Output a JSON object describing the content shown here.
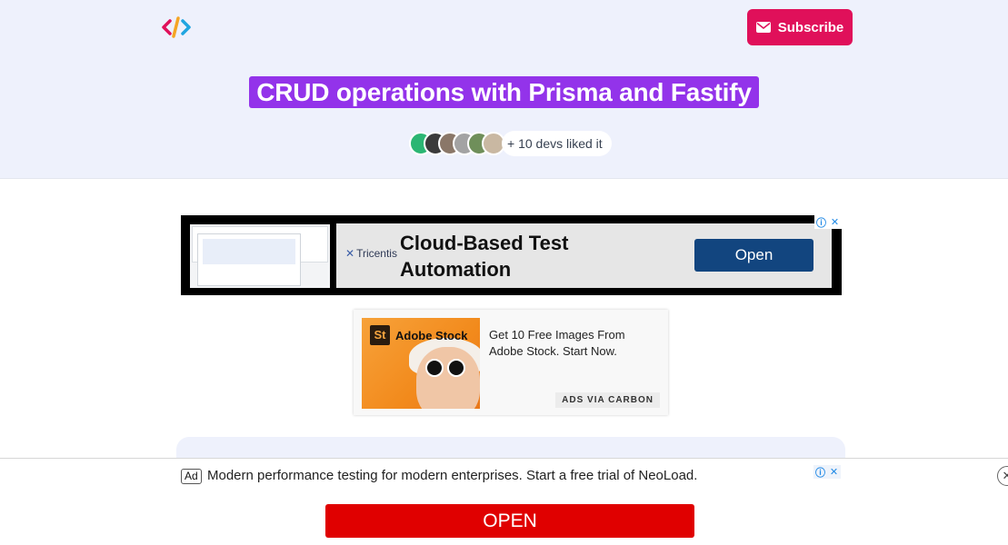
{
  "header": {
    "logo_icon": "code-brackets-icon",
    "subscribe_label": "Subscribe",
    "subscribe_icon": "envelope-icon",
    "accent": "#e0105a"
  },
  "article": {
    "title": "CRUD operations with Prisma and Fastify",
    "title_bg": "#9333ea",
    "likes_text": "+ 10 devs liked it",
    "avatar_count": 6
  },
  "ad_banner": {
    "brand": "Tricentis",
    "headline_line1": "Cloud-Based Test",
    "headline_line2": "Automation",
    "cta": "Open",
    "choice_icons": [
      "info-icon",
      "close-icon"
    ]
  },
  "carbon_ad": {
    "image_brand": "Adobe Stock",
    "image_badge": "St",
    "text": "Get 10 Free Images From Adobe Stock. Start Now.",
    "label": "ADS VIA CARBON"
  },
  "bottom_ad": {
    "tag": "Ad",
    "text": "Modern performance testing for modern enterprises. Start a free trial of NeoLoad.",
    "cta": "OPEN",
    "close_icon": "close-icon"
  }
}
